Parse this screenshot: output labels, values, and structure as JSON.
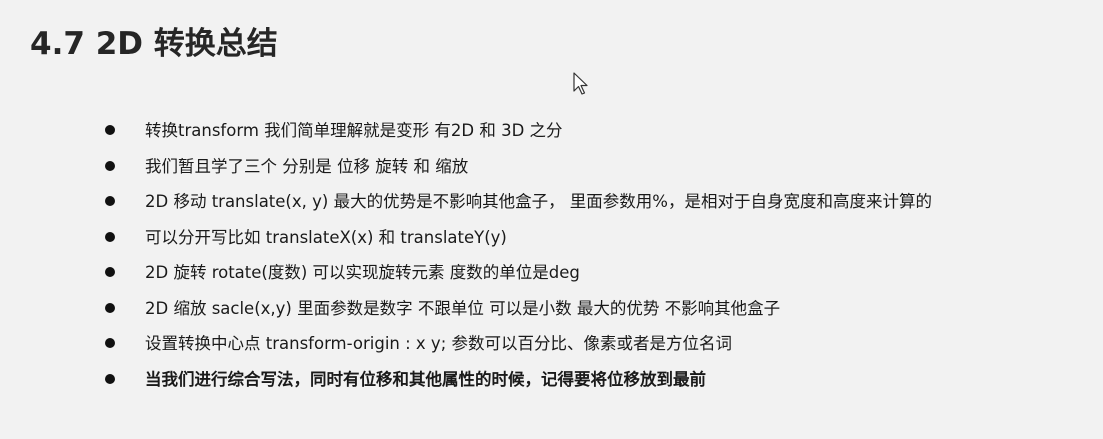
{
  "title": "4.7 2D 转换总结",
  "bullets": [
    {
      "text": "转换transform 我们简单理解就是变形 有2D 和 3D 之分",
      "bold": false
    },
    {
      "text": "我们暂且学了三个 分别是 位移 旋转 和 缩放",
      "bold": false
    },
    {
      "text": "2D 移动 translate(x, y)   最大的优势是不影响其他盒子， 里面参数用%，是相对于自身宽度和高度来计算的",
      "bold": false
    },
    {
      "text": "可以分开写比如 translateX(x)  和 translateY(y)",
      "bold": false
    },
    {
      "text": "2D 旋转 rotate(度数)    可以实现旋转元素   度数的单位是deg",
      "bold": false
    },
    {
      "text": "2D 缩放 sacle(x,y)   里面参数是数字 不跟单位 可以是小数   最大的优势 不影响其他盒子",
      "bold": false
    },
    {
      "text": "设置转换中心点 transform-origin : x y;    参数可以百分比、像素或者是方位名词",
      "bold": false
    },
    {
      "text": "当我们进行综合写法，同时有位移和其他属性的时候，记得要将位移放到最前",
      "bold": true
    }
  ],
  "icons": {
    "cursor": "mouse-pointer-icon",
    "bullet": "bullet-dot-icon"
  },
  "colors": {
    "background": "#f2f2f2",
    "title": "#262626",
    "text": "#1a1a1a"
  }
}
